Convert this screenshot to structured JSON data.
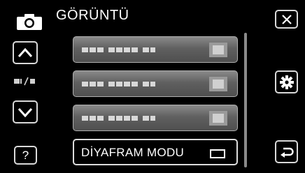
{
  "header": {
    "title": "GÖRÜNTÜ",
    "mode_icon": "camera-icon"
  },
  "nav": {
    "up_icon": "chevron-up-icon",
    "down_icon": "chevron-down-icon",
    "page_indicator_icon": "page-indicator-icon",
    "help_label": "?"
  },
  "menu": {
    "items": [
      {
        "label": "",
        "selected": false
      },
      {
        "label": "",
        "selected": false
      },
      {
        "label": "",
        "selected": false
      },
      {
        "label": "DİYAFRAM MODU",
        "selected": true,
        "icon": "aperture-mode-icon"
      }
    ]
  },
  "side": {
    "close_icon": "close-icon",
    "settings_icon": "gear-icon",
    "back_icon": "return-icon"
  }
}
